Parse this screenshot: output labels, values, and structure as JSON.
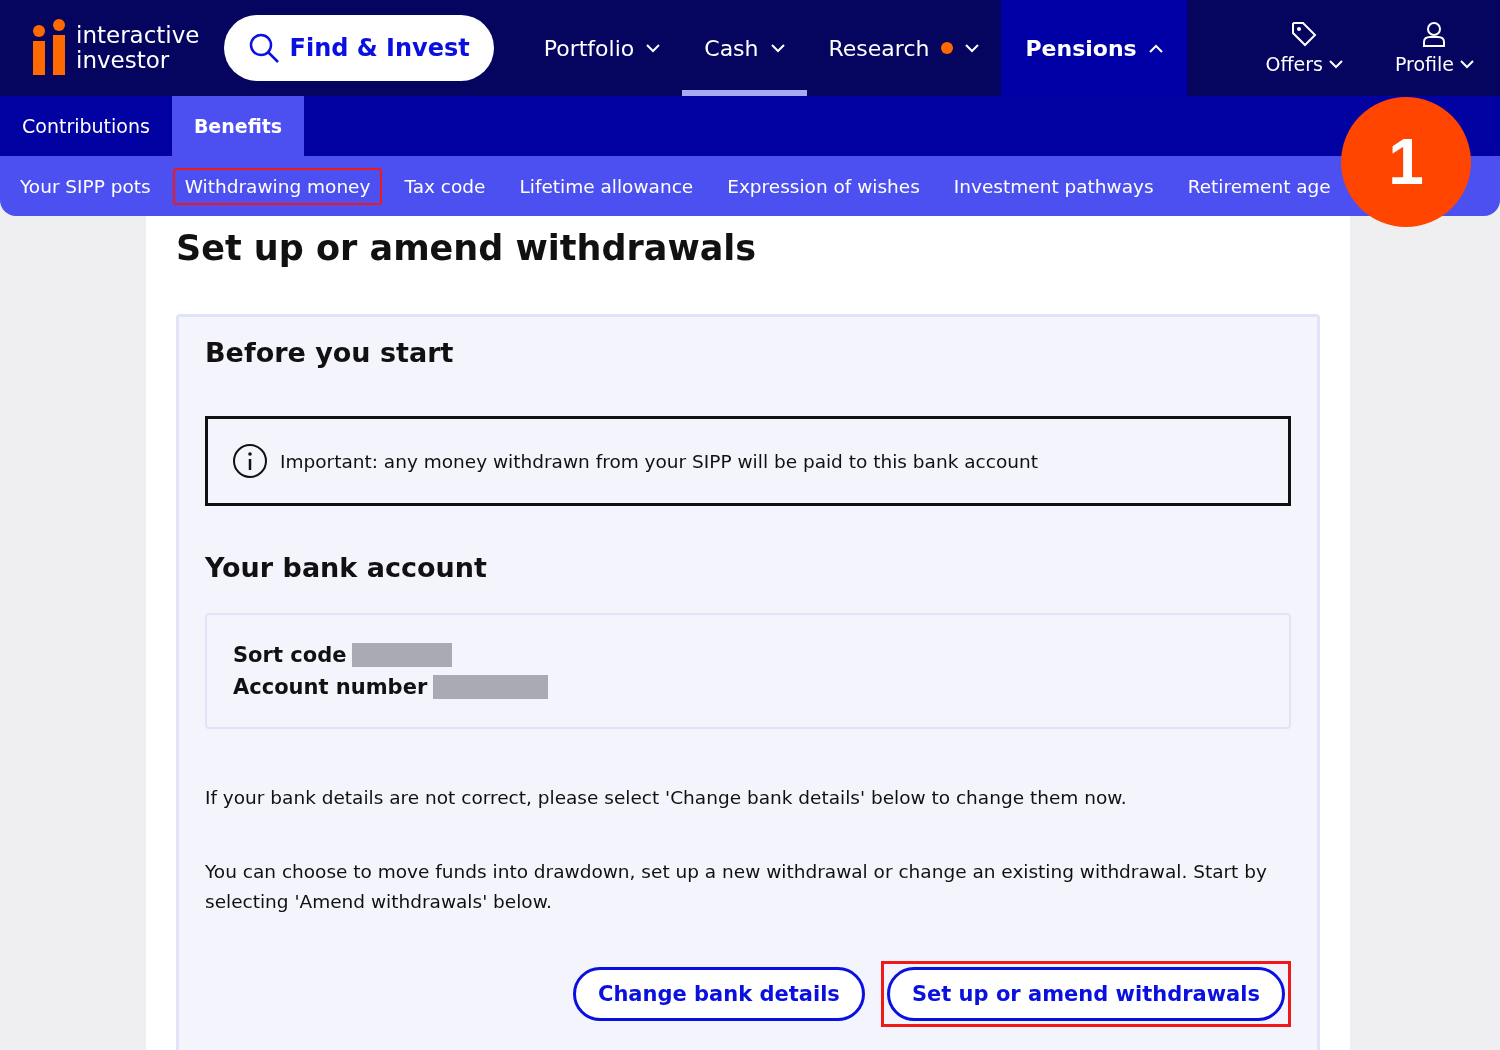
{
  "logo": {
    "line_1": "interactive",
    "line_2": "investor"
  },
  "search_button": {
    "label": "Find & Invest"
  },
  "main_nav": [
    {
      "label": "Portfolio",
      "selected": false,
      "underlined": false,
      "dot": false,
      "expanded": false
    },
    {
      "label": "Cash",
      "selected": false,
      "underlined": true,
      "dot": false,
      "expanded": false
    },
    {
      "label": "Research",
      "selected": false,
      "underlined": false,
      "dot": true,
      "expanded": false
    },
    {
      "label": "Pensions",
      "selected": true,
      "underlined": false,
      "dot": false,
      "expanded": true
    }
  ],
  "utility_nav": [
    {
      "label": "Offers",
      "kind": "tag"
    },
    {
      "label": "Profile",
      "kind": "person"
    }
  ],
  "tabs": [
    {
      "label": "Contributions",
      "selected": false
    },
    {
      "label": "Benefits",
      "selected": true
    }
  ],
  "sub_nav": [
    {
      "label": "Your SIPP pots",
      "highlighted": false
    },
    {
      "label": "Withdrawing money",
      "highlighted": true
    },
    {
      "label": "Tax code",
      "highlighted": false
    },
    {
      "label": "Lifetime allowance",
      "highlighted": false
    },
    {
      "label": "Expression of wishes",
      "highlighted": false
    },
    {
      "label": "Investment pathways",
      "highlighted": false
    },
    {
      "label": "Retirement age",
      "highlighted": false
    }
  ],
  "step_badge": "1",
  "page_title": "Set up or amend withdrawals",
  "card": {
    "heading": "Before you start",
    "notice": "Important: any money withdrawn from your SIPP will be paid to this bank account",
    "bank_heading": "Your bank account",
    "bank_fields": [
      {
        "label": "Sort code",
        "redacted": true
      },
      {
        "label": "Account number",
        "redacted": true
      }
    ],
    "paragraphs": [
      "If your bank details are not correct, please select 'Change bank details' below to change them now.",
      "You can choose to move funds into drawdown, set up a new withdrawal or change an existing withdrawal. Start by selecting 'Amend withdrawals' below."
    ],
    "buttons": [
      {
        "label": "Change bank details",
        "highlighted": false
      },
      {
        "label": "Set up or amend withdrawals",
        "highlighted": true
      }
    ]
  }
}
